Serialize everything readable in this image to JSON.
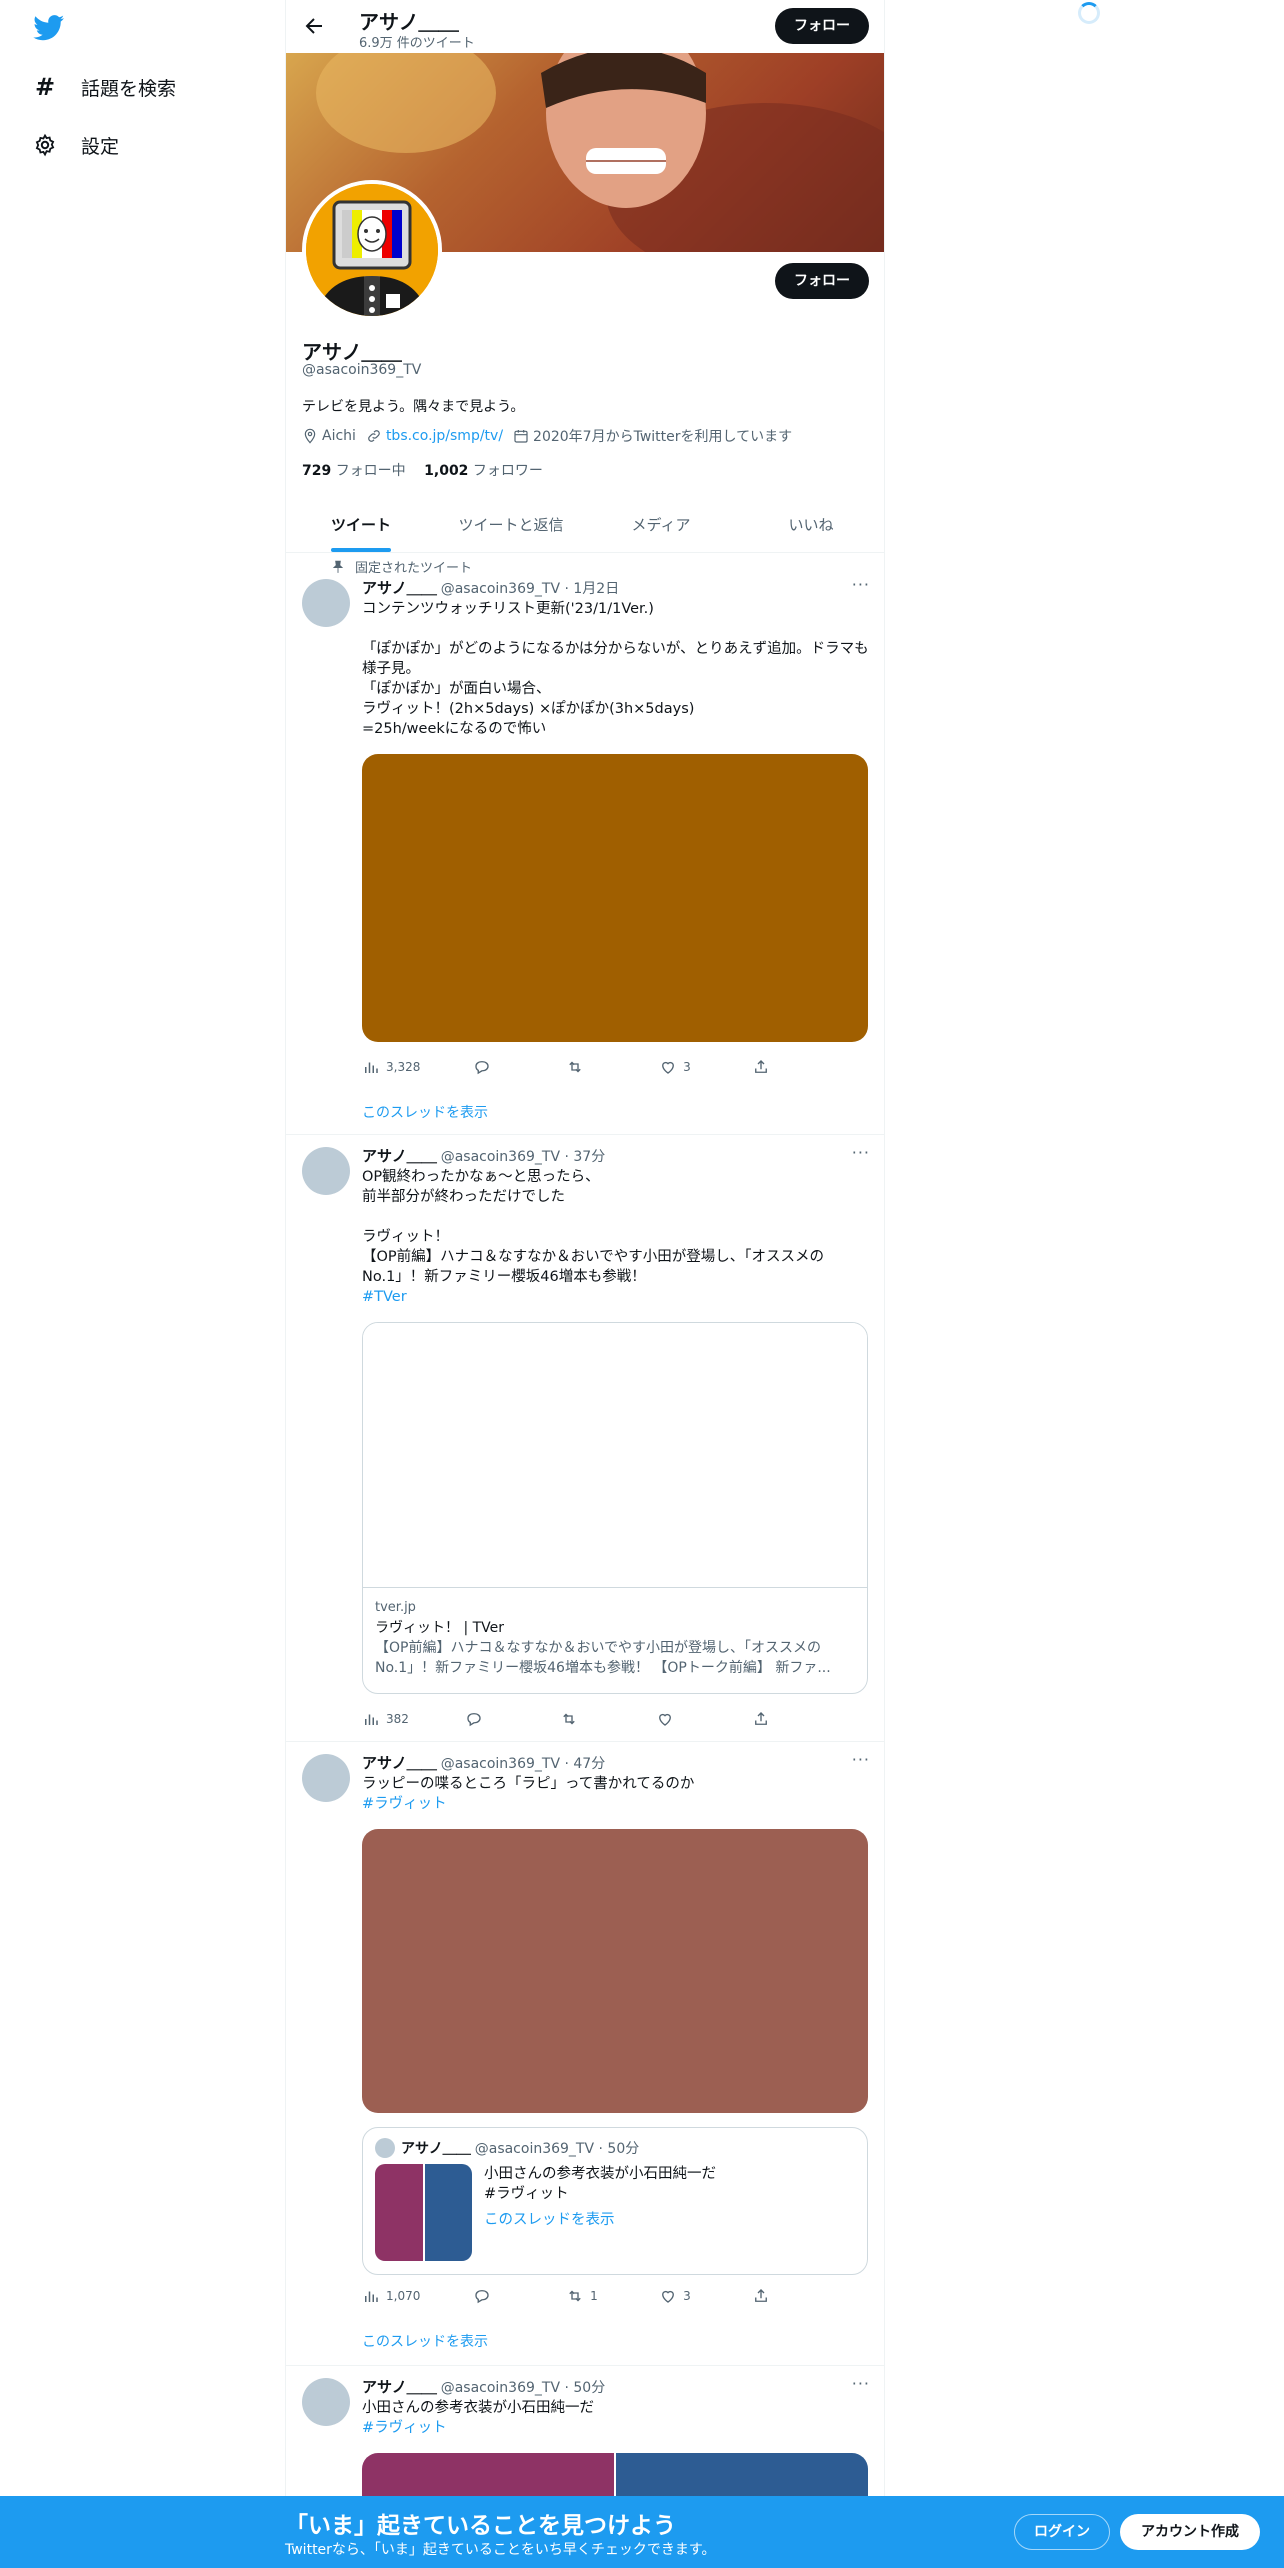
{
  "nav": {
    "logo_icon": "twitter-bird-icon",
    "items": [
      {
        "icon": "hashtag-icon",
        "label": "話題を検索"
      },
      {
        "icon": "gear-icon",
        "label": "設定"
      }
    ]
  },
  "header": {
    "name": "アサノ＿＿",
    "tweet_count": "6.9万 件のツイート",
    "follow_label": "フォロー"
  },
  "profile": {
    "name": "アサノ＿＿",
    "handle": "@asacoin369_TV",
    "bio": "テレビを見よう。隅々まで見よう。",
    "location": "Aichi",
    "link": "tbs.co.jp/smp/tv/",
    "joined": "2020年7月からTwitterを利用しています",
    "following_count": "729",
    "following_label": "フォロー中",
    "followers_count": "1,002",
    "followers_label": "フォロワー",
    "follow_label": "フォロー"
  },
  "tabs": [
    "ツイート",
    "ツイートと返信",
    "メディア",
    "いいね"
  ],
  "pinned_label": "固定されたツイート",
  "tweets": [
    {
      "name": "アサノ＿＿",
      "meta": "@asacoin369_TV · 1月2日",
      "text": "コンテンツウォッチリスト更新('23/1/1Ver.)\n\n「ぽかぽか」がどのようになるかは分からないが、とりあえず追加。ドラマも様子見。\n「ぽかぽか」が面白い場合、\nラヴィット！(2h×5days) ×ぽかぽか(3h×5days)\n=25h/weekになるので怖い",
      "media_color": "#a05f00",
      "views": "3,328",
      "retweets": "",
      "likes": "3",
      "thread_label": "このスレッドを表示"
    },
    {
      "name": "アサノ＿＿",
      "meta": "@asacoin369_TV · 37分",
      "text": "OP観終わったかなぁ～と思ったら、\n前半部分が終わっただけでした\n\nラヴィット！\n【OP前編】ハナコ＆なすなか＆おいでやす小田が登場し、「オススメのNo.1」！新ファミリー櫻坂46増本も参戦！",
      "hashtag": "#TVer",
      "card_domain": "tver.jp",
      "card_title": "ラヴィット！ | TVer",
      "card_desc": "【OP前編】ハナコ＆なすなか＆おいでやす小田が登場し、「オススメのNo.1」！新ファミリー櫻坂46増本も参戦！ 【OPトーク前編】 新ファ...",
      "views": "382",
      "retweets": "",
      "likes": ""
    },
    {
      "name": "アサノ＿＿",
      "meta": "@asacoin369_TV · 47分",
      "text": "ラッピーの喋るところ「ラピ」って書かれてるのか",
      "hashtag": "#ラヴィット",
      "media_color": "#9c5f52",
      "quote": {
        "name": "アサノ＿＿",
        "meta": "@asacoin369_TV · 50分",
        "text": "小田さんの参考衣装が小石田純一だ",
        "hashtag": "#ラヴィット",
        "thread_label": "このスレッドを表示"
      },
      "views": "1,070",
      "retweets": "1",
      "likes": "3",
      "thread_label": "このスレッドを表示"
    },
    {
      "name": "アサノ＿＿",
      "meta": "@asacoin369_TV · 50分",
      "text": "小田さんの参考衣装が小石田純一だ",
      "hashtag": "#ラヴィット"
    }
  ],
  "bottom_bar": {
    "title": "「いま」起きていることを見つけよう",
    "subtitle": "Twitterなら、「いま」起きていることをいち早くチェックできます。",
    "login_label": "ログイン",
    "signup_label": "アカウント作成"
  },
  "colors": {
    "accent": "#1d9bf0",
    "text": "#0f1419",
    "muted": "#536471"
  }
}
